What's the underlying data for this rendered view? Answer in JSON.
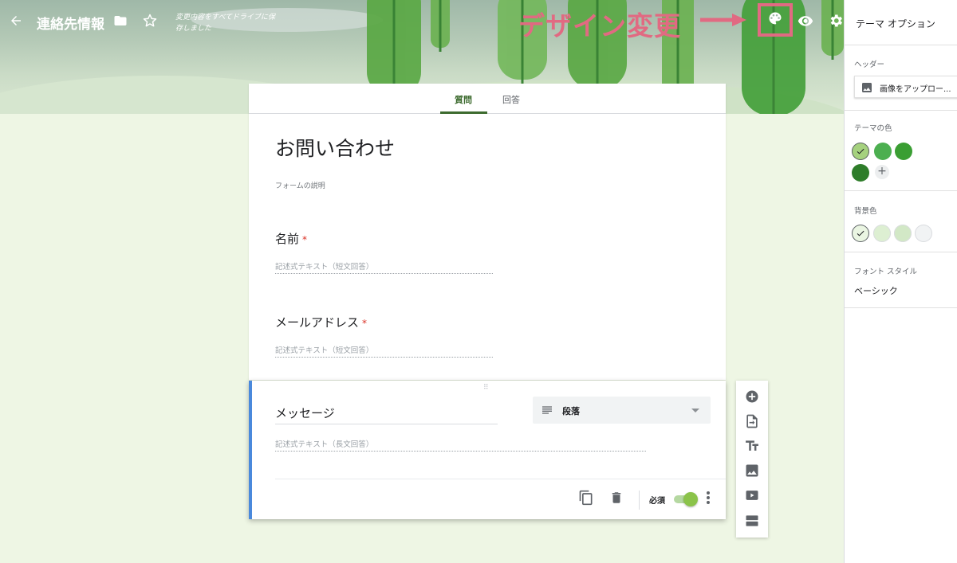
{
  "header": {
    "title": "連絡先情報",
    "saved_status": "変更内容をすべてドライブに保存しました",
    "annotation": "デザイン変更",
    "icons": [
      "arrow-back-icon",
      "folder-icon",
      "star-icon",
      "palette-icon",
      "eye-icon",
      "gear-icon"
    ]
  },
  "tabs": {
    "questions": "質問",
    "responses": "回答"
  },
  "form": {
    "title": "お問い合わせ",
    "description": "フォームの説明",
    "questions": [
      {
        "label": "名前",
        "required_mark": "*",
        "hint": "記述式テキスト（短文回答）"
      },
      {
        "label": "メールアドレス",
        "required_mark": "*",
        "hint": "記述式テキスト（短文回答）"
      }
    ],
    "active_question": {
      "drag_handle": "⠿",
      "title": "メッセージ",
      "type": "段落",
      "hint": "記述式テキスト（長文回答）",
      "required_label": "必須",
      "required_on": true
    }
  },
  "theme_panel": {
    "title": "テーマ オプション",
    "header_label": "ヘッダー",
    "upload_label": "画像をアップロー...",
    "theme_color_label": "テーマの色",
    "theme_colors": [
      "#a5d17e",
      "#4caf50",
      "#3a9e33",
      "#2e7d2a"
    ],
    "add_label": "+",
    "bg_color_label": "背景色",
    "bg_colors": [
      "#eaf5e2",
      "#ddefd2",
      "#d2e8c6",
      "#f1f3f4"
    ],
    "font_style_label": "フォント スタイル",
    "font_style_value": "ベーシック"
  },
  "colors": {
    "accent": "#3d6b2f",
    "annotation": "#e16a82",
    "active_border": "#4a89dc"
  }
}
